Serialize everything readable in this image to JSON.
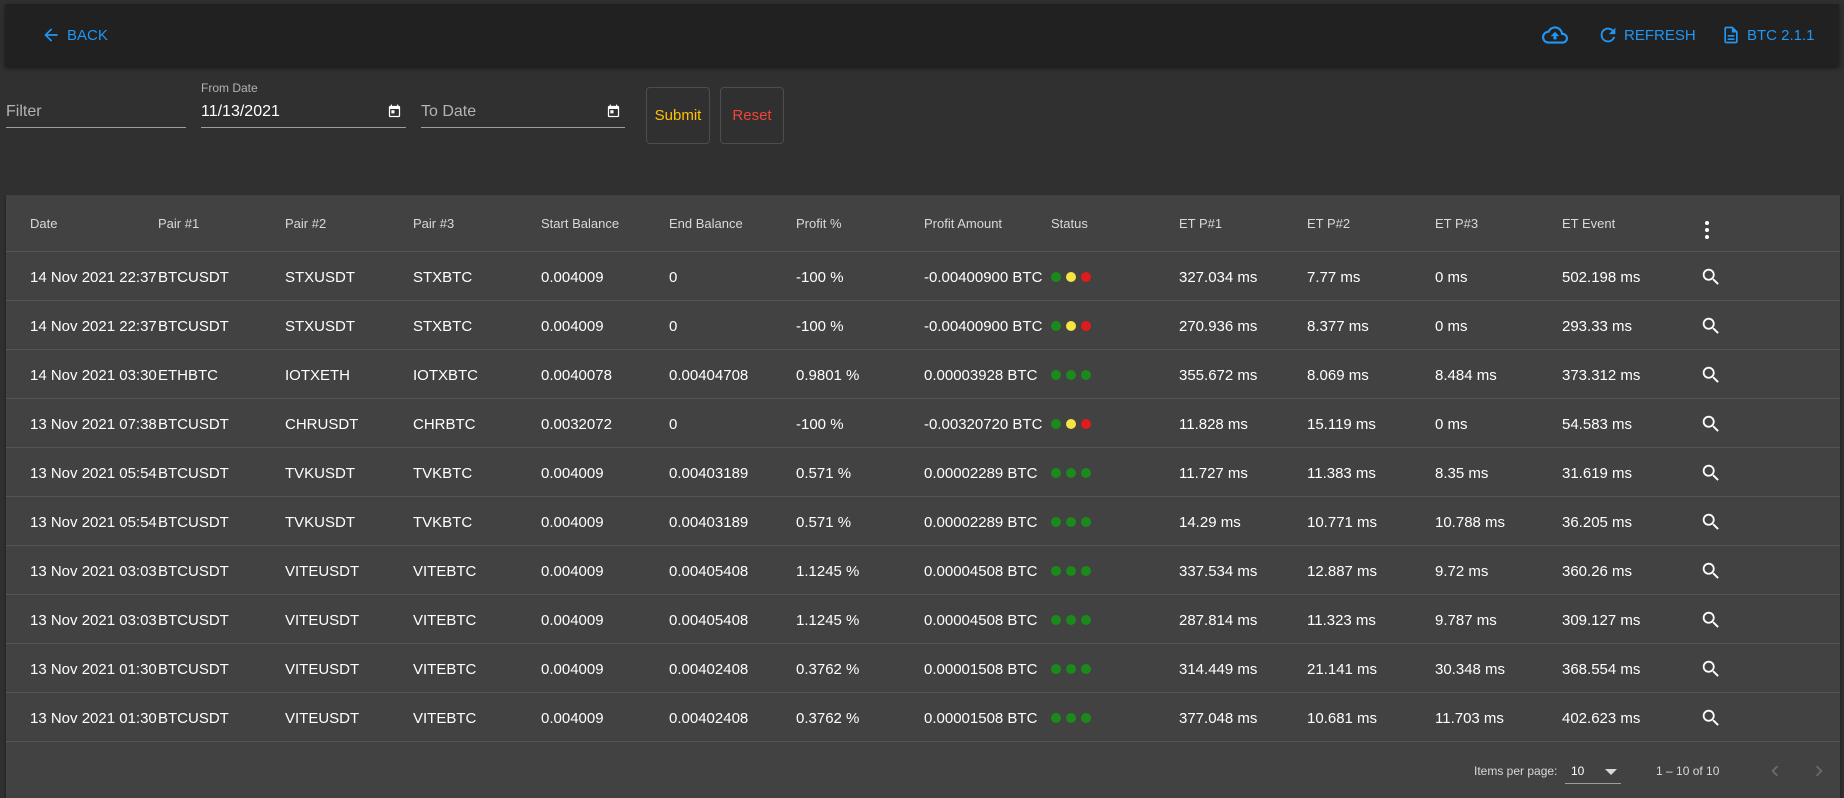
{
  "toolbar": {
    "back_label": "BACK",
    "refresh_label": "REFRESH",
    "version_label": "BTC 2.1.1",
    "accent_color": "#2196f3"
  },
  "filters": {
    "filter_placeholder": "Filter",
    "from_date_label": "From Date",
    "from_date_value": "11/13/2021",
    "to_date_placeholder": "To Date",
    "submit_label": "Submit",
    "reset_label": "Reset",
    "submit_color": "#ffc107",
    "reset_color": "#f44336"
  },
  "table": {
    "columns": [
      "Date",
      "Pair #1",
      "Pair #2",
      "Pair #3",
      "Start Balance",
      "End Balance",
      "Profit %",
      "Profit Amount",
      "Status",
      "ET P#1",
      "ET P#2",
      "ET P#3",
      "ET Event"
    ],
    "status_colors": {
      "green": "#1b8a1b",
      "yellow": "#f4e542",
      "red": "#e01b1b"
    },
    "rows": [
      {
        "date": "14 Nov 2021 22:37",
        "pair1": "BTCUSDT",
        "pair2": "STXUSDT",
        "pair3": "STXBTC",
        "start_balance": "0.004009",
        "end_balance": "0",
        "profit_pct": "-100 %",
        "profit_amount": "-0.00400900 BTC",
        "status": [
          "green",
          "yellow",
          "red"
        ],
        "et1": "327.034 ms",
        "et2": "7.77 ms",
        "et3": "0 ms",
        "et_event": "502.198 ms"
      },
      {
        "date": "14 Nov 2021 22:37",
        "pair1": "BTCUSDT",
        "pair2": "STXUSDT",
        "pair3": "STXBTC",
        "start_balance": "0.004009",
        "end_balance": "0",
        "profit_pct": "-100 %",
        "profit_amount": "-0.00400900 BTC",
        "status": [
          "green",
          "yellow",
          "red"
        ],
        "et1": "270.936 ms",
        "et2": "8.377 ms",
        "et3": "0 ms",
        "et_event": "293.33 ms"
      },
      {
        "date": "14 Nov 2021 03:30",
        "pair1": "ETHBTC",
        "pair2": "IOTXETH",
        "pair3": "IOTXBTC",
        "start_balance": "0.0040078",
        "end_balance": "0.00404708",
        "profit_pct": "0.9801 %",
        "profit_amount": "0.00003928 BTC",
        "status": [
          "green",
          "green",
          "green"
        ],
        "et1": "355.672 ms",
        "et2": "8.069 ms",
        "et3": "8.484 ms",
        "et_event": "373.312 ms"
      },
      {
        "date": "13 Nov 2021 07:38",
        "pair1": "BTCUSDT",
        "pair2": "CHRUSDT",
        "pair3": "CHRBTC",
        "start_balance": "0.0032072",
        "end_balance": "0",
        "profit_pct": "-100 %",
        "profit_amount": "-0.00320720 BTC",
        "status": [
          "green",
          "yellow",
          "red"
        ],
        "et1": "11.828 ms",
        "et2": "15.119 ms",
        "et3": "0 ms",
        "et_event": "54.583 ms"
      },
      {
        "date": "13 Nov 2021 05:54",
        "pair1": "BTCUSDT",
        "pair2": "TVKUSDT",
        "pair3": "TVKBTC",
        "start_balance": "0.004009",
        "end_balance": "0.00403189",
        "profit_pct": "0.571 %",
        "profit_amount": "0.00002289 BTC",
        "status": [
          "green",
          "green",
          "green"
        ],
        "et1": "11.727 ms",
        "et2": "11.383 ms",
        "et3": "8.35 ms",
        "et_event": "31.619 ms"
      },
      {
        "date": "13 Nov 2021 05:54",
        "pair1": "BTCUSDT",
        "pair2": "TVKUSDT",
        "pair3": "TVKBTC",
        "start_balance": "0.004009",
        "end_balance": "0.00403189",
        "profit_pct": "0.571 %",
        "profit_amount": "0.00002289 BTC",
        "status": [
          "green",
          "green",
          "green"
        ],
        "et1": "14.29 ms",
        "et2": "10.771 ms",
        "et3": "10.788 ms",
        "et_event": "36.205 ms"
      },
      {
        "date": "13 Nov 2021 03:03",
        "pair1": "BTCUSDT",
        "pair2": "VITEUSDT",
        "pair3": "VITEBTC",
        "start_balance": "0.004009",
        "end_balance": "0.00405408",
        "profit_pct": "1.1245 %",
        "profit_amount": "0.00004508 BTC",
        "status": [
          "green",
          "green",
          "green"
        ],
        "et1": "337.534 ms",
        "et2": "12.887 ms",
        "et3": "9.72 ms",
        "et_event": "360.26 ms"
      },
      {
        "date": "13 Nov 2021 03:03",
        "pair1": "BTCUSDT",
        "pair2": "VITEUSDT",
        "pair3": "VITEBTC",
        "start_balance": "0.004009",
        "end_balance": "0.00405408",
        "profit_pct": "1.1245 %",
        "profit_amount": "0.00004508 BTC",
        "status": [
          "green",
          "green",
          "green"
        ],
        "et1": "287.814 ms",
        "et2": "11.323 ms",
        "et3": "9.787 ms",
        "et_event": "309.127 ms"
      },
      {
        "date": "13 Nov 2021 01:30",
        "pair1": "BTCUSDT",
        "pair2": "VITEUSDT",
        "pair3": "VITEBTC",
        "start_balance": "0.004009",
        "end_balance": "0.00402408",
        "profit_pct": "0.3762 %",
        "profit_amount": "0.00001508 BTC",
        "status": [
          "green",
          "green",
          "green"
        ],
        "et1": "314.449 ms",
        "et2": "21.141 ms",
        "et3": "30.348 ms",
        "et_event": "368.554 ms"
      },
      {
        "date": "13 Nov 2021 01:30",
        "pair1": "BTCUSDT",
        "pair2": "VITEUSDT",
        "pair3": "VITEBTC",
        "start_balance": "0.004009",
        "end_balance": "0.00402408",
        "profit_pct": "0.3762 %",
        "profit_amount": "0.00001508 BTC",
        "status": [
          "green",
          "green",
          "green"
        ],
        "et1": "377.048 ms",
        "et2": "10.681 ms",
        "et3": "11.703 ms",
        "et_event": "402.623 ms"
      }
    ]
  },
  "paginator": {
    "items_per_page_label": "Items per page:",
    "items_per_page_value": "10",
    "range_label": "1 – 10 of 10"
  }
}
